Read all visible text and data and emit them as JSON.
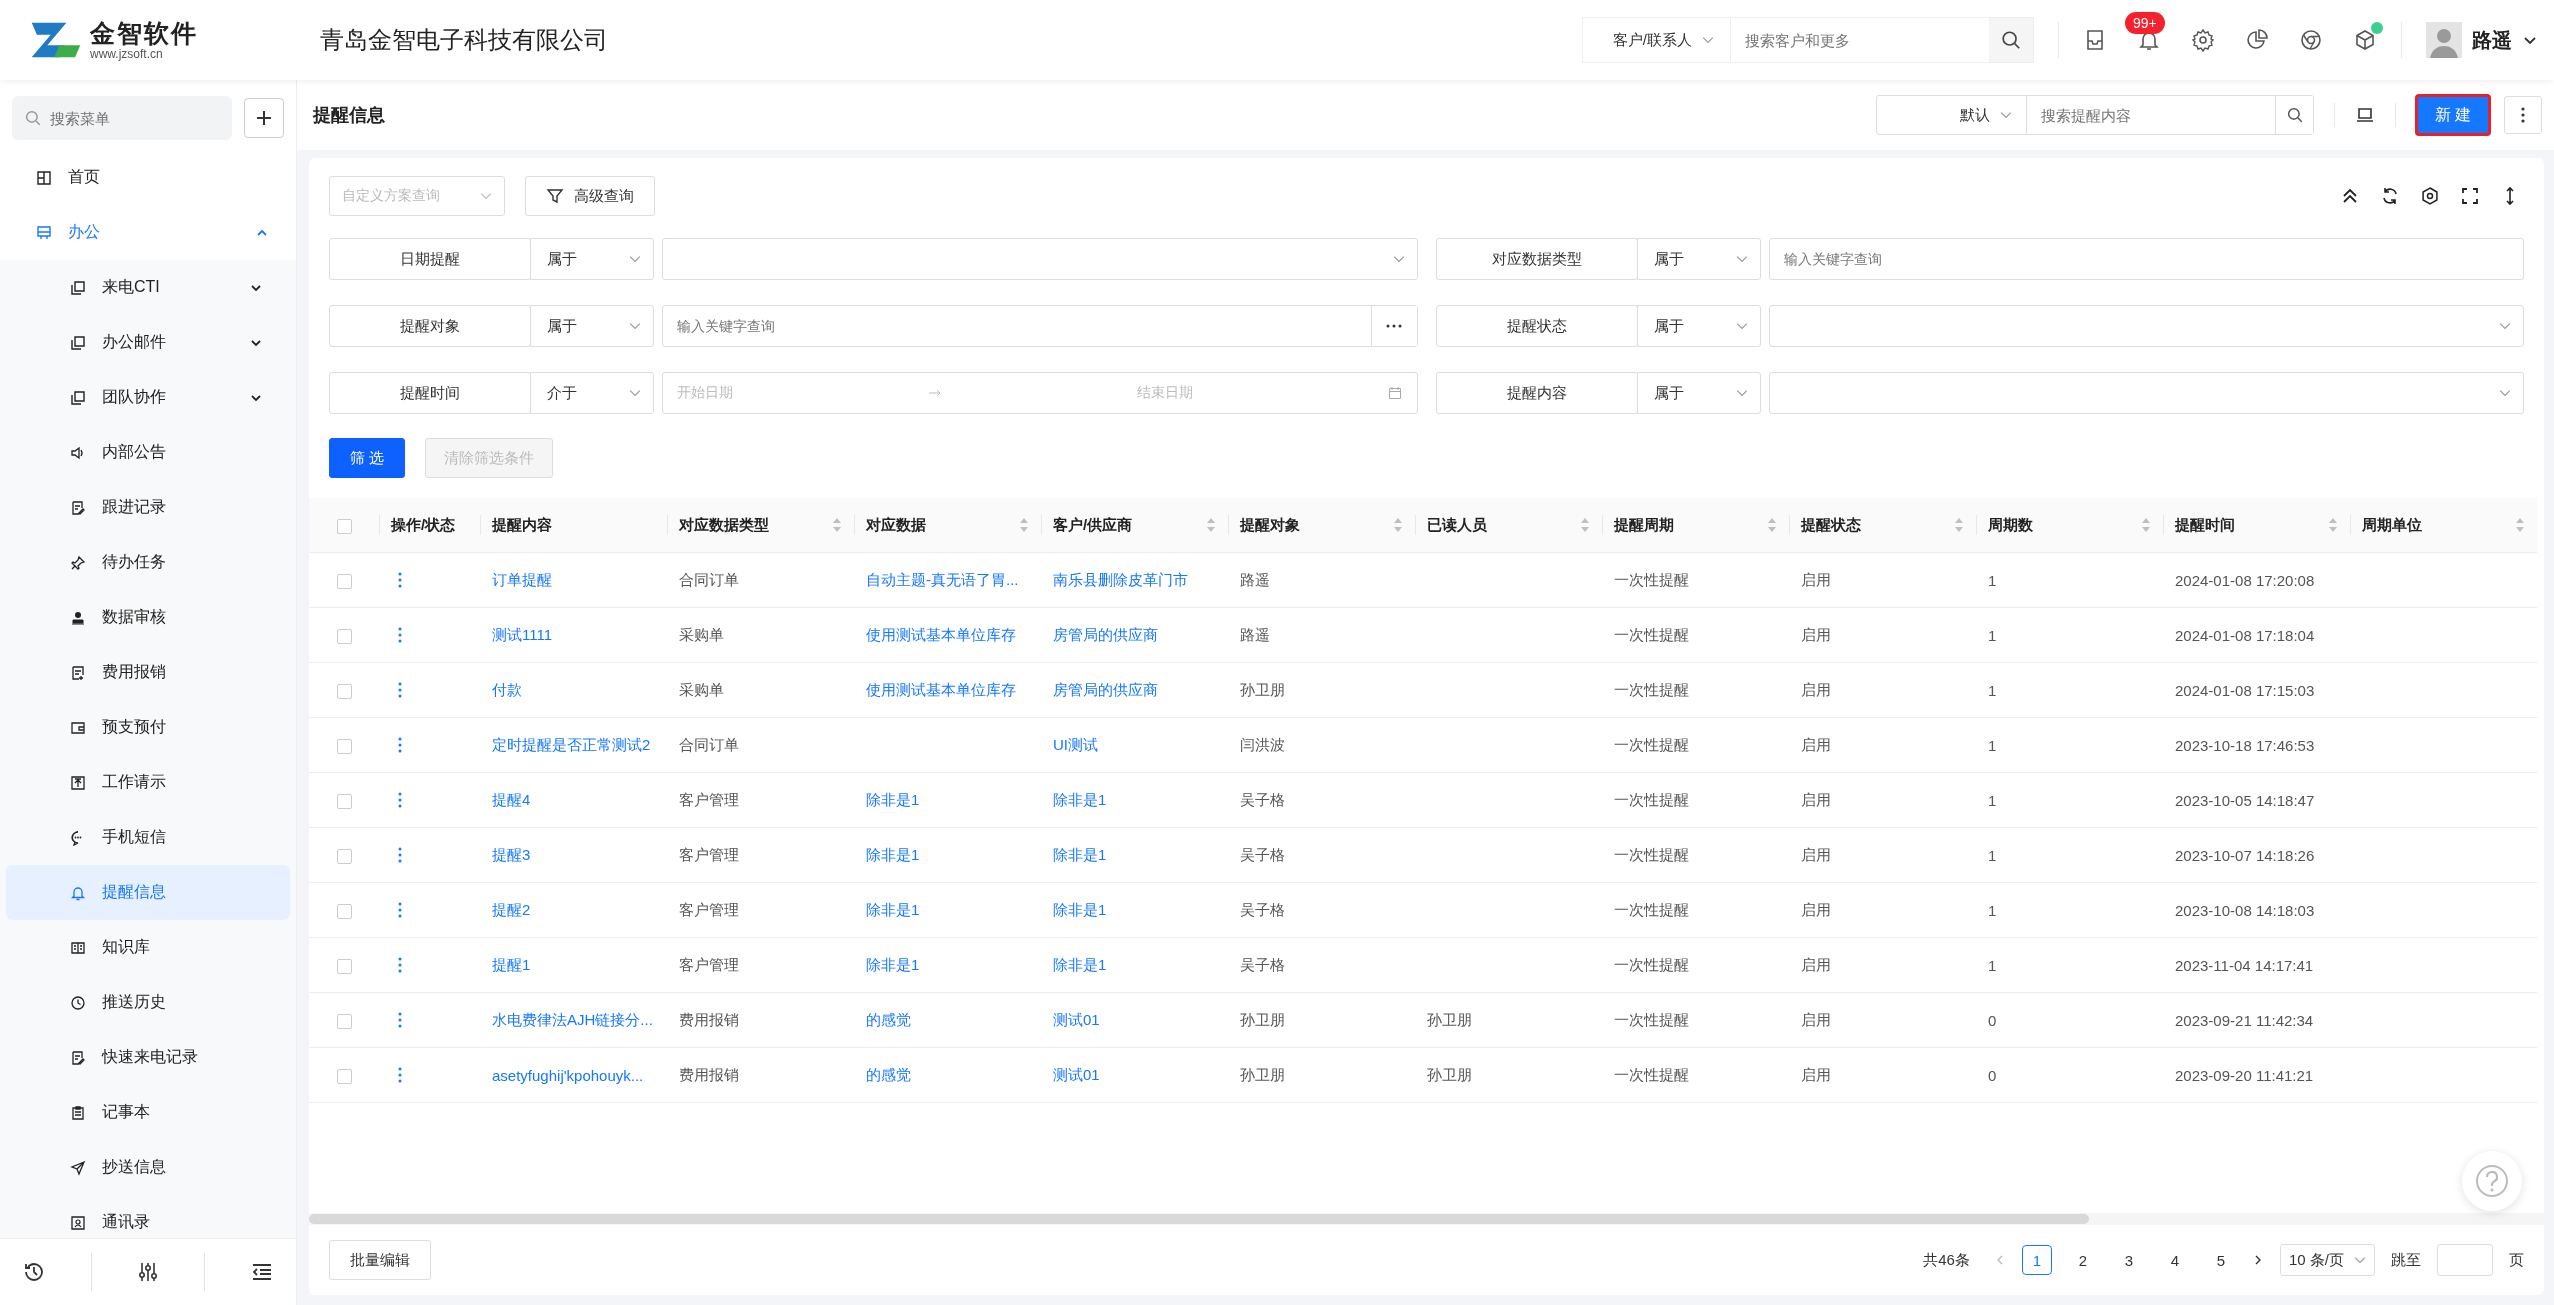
{
  "header": {
    "logo_name": "金智软件",
    "logo_url": "www.jzsoft.cn",
    "company": "青岛金智电子科技有限公司",
    "search_scope": "客户/联系人",
    "search_placeholder": "搜索客户和更多",
    "notification_badge": "99+",
    "user_name": "路遥"
  },
  "sidebar": {
    "search_placeholder": "搜索菜单",
    "items": [
      {
        "label": "首页",
        "selected": false
      },
      {
        "label": "办公",
        "selected": false,
        "expanded": true,
        "children": [
          {
            "label": "来电CTI",
            "selected": false,
            "expanded": false
          },
          {
            "label": "办公邮件",
            "selected": false,
            "expanded": false
          },
          {
            "label": "团队协作",
            "selected": false,
            "expanded": false
          },
          {
            "label": "内部公告",
            "selected": false
          },
          {
            "label": "跟进记录",
            "selected": false
          },
          {
            "label": "待办任务",
            "selected": false
          },
          {
            "label": "数据审核",
            "selected": false
          },
          {
            "label": "费用报销",
            "selected": false
          },
          {
            "label": "预支预付",
            "selected": false
          },
          {
            "label": "工作请示",
            "selected": false
          },
          {
            "label": "手机短信",
            "selected": false
          },
          {
            "label": "提醒信息",
            "selected": true
          },
          {
            "label": "知识库",
            "selected": false
          },
          {
            "label": "推送历史",
            "selected": false
          },
          {
            "label": "快速来电记录",
            "selected": false
          },
          {
            "label": "记事本",
            "selected": false
          },
          {
            "label": "抄送信息",
            "selected": false
          },
          {
            "label": "通讯录",
            "selected": false
          }
        ]
      }
    ]
  },
  "page": {
    "title": "提醒信息",
    "view": "默认",
    "search_placeholder": "搜索提醒内容",
    "new_button": {
      "label": "新 建",
      "focused": true
    }
  },
  "filter_bar": {
    "scheme_placeholder": "自定义方案查询",
    "advanced_button": "高级查询",
    "filters": [
      {
        "label": "日期提醒",
        "operator": "属于",
        "kind": "select"
      },
      {
        "label": "对应数据类型",
        "operator": "属于",
        "kind": "text",
        "placeholder": "输入关键字查询"
      },
      {
        "label": "提醒对象",
        "operator": "属于",
        "kind": "lookup",
        "placeholder": "输入关键字查询"
      },
      {
        "label": "提醒状态",
        "operator": "属于",
        "kind": "select"
      },
      {
        "label": "提醒时间",
        "operator": "介于",
        "kind": "daterange",
        "start_placeholder": "开始日期",
        "end_placeholder": "结束日期"
      },
      {
        "label": "提醒内容",
        "operator": "属于",
        "kind": "select"
      }
    ],
    "buttons": [
      {
        "label": "筛 选",
        "kind": "primary",
        "disabled": false
      },
      {
        "label": "清除筛选条件",
        "kind": "default",
        "disabled": true
      }
    ]
  },
  "table": {
    "select_all_checked": false,
    "actions_column": "操作/状态",
    "columns": [
      {
        "label": "提醒内容",
        "sortable": false,
        "kind": "link"
      },
      {
        "label": "对应数据类型",
        "sortable": true,
        "kind": "text"
      },
      {
        "label": "对应数据",
        "sortable": true,
        "kind": "link"
      },
      {
        "label": "客户/供应商",
        "sortable": true,
        "kind": "link"
      },
      {
        "label": "提醒对象",
        "sortable": true,
        "kind": "text"
      },
      {
        "label": "已读人员",
        "sortable": true,
        "kind": "text"
      },
      {
        "label": "提醒周期",
        "sortable": true,
        "kind": "text"
      },
      {
        "label": "提醒状态",
        "sortable": true,
        "kind": "text"
      },
      {
        "label": "周期数",
        "sortable": true,
        "kind": "text"
      },
      {
        "label": "提醒时间",
        "sortable": true,
        "kind": "text"
      },
      {
        "label": "周期单位",
        "sortable": true
      }
    ],
    "rows": [
      {
        "checked": false,
        "cells": [
          "订单提醒",
          "合同订单",
          "自动主题-真无语了胃...",
          "南乐县删除皮革门市",
          "路遥",
          null,
          "一次性提醒",
          "启用",
          "1",
          "2024-01-08 17:20:08",
          null
        ]
      },
      {
        "checked": false,
        "cells": [
          "测试1111",
          "采购单",
          "使用测试基本单位库存",
          "房管局的供应商",
          "路遥",
          null,
          "一次性提醒",
          "启用",
          "1",
          "2024-01-08 17:18:04",
          null
        ]
      },
      {
        "checked": false,
        "cells": [
          "付款",
          "采购单",
          "使用测试基本单位库存",
          "房管局的供应商",
          "孙卫朋",
          null,
          "一次性提醒",
          "启用",
          "1",
          "2024-01-08 17:15:03",
          null
        ]
      },
      {
        "checked": false,
        "cells": [
          "定时提醒是否正常测试2",
          "合同订单",
          null,
          "UI测试",
          "闫洪波",
          null,
          "一次性提醒",
          "启用",
          "1",
          "2023-10-18 17:46:53",
          null
        ]
      },
      {
        "checked": false,
        "cells": [
          "提醒4",
          "客户管理",
          "除非是1",
          "除非是1",
          "吴子格",
          null,
          "一次性提醒",
          "启用",
          "1",
          "2023-10-05 14:18:47",
          null
        ]
      },
      {
        "checked": false,
        "cells": [
          "提醒3",
          "客户管理",
          "除非是1",
          "除非是1",
          "吴子格",
          null,
          "一次性提醒",
          "启用",
          "1",
          "2023-10-07 14:18:26",
          null
        ]
      },
      {
        "checked": false,
        "cells": [
          "提醒2",
          "客户管理",
          "除非是1",
          "除非是1",
          "吴子格",
          null,
          "一次性提醒",
          "启用",
          "1",
          "2023-10-08 14:18:03",
          null
        ]
      },
      {
        "checked": false,
        "cells": [
          "提醒1",
          "客户管理",
          "除非是1",
          "除非是1",
          "吴子格",
          null,
          "一次性提醒",
          "启用",
          "1",
          "2023-11-04 14:17:41",
          null
        ]
      },
      {
        "checked": false,
        "cells": [
          "水电费律法AJH链接分...",
          "费用报销",
          "的感觉",
          "测试01",
          "孙卫朋",
          "孙卫朋",
          "一次性提醒",
          "启用",
          "0",
          "2023-09-21 11:42:34",
          null
        ]
      },
      {
        "checked": false,
        "cells": [
          "asetyfughij'kpohouyk...",
          "费用报销",
          "的感觉",
          "测试01",
          "孙卫朋",
          "孙卫朋",
          "一次性提醒",
          "启用",
          "0",
          "2023-09-20 11:41:21",
          null
        ]
      }
    ]
  },
  "footer": {
    "batch_button": "批量编辑",
    "total": "共46条",
    "pages": [
      {
        "label": "1",
        "selected": true
      },
      {
        "label": "2",
        "selected": false
      },
      {
        "label": "3",
        "selected": false
      },
      {
        "label": "4",
        "selected": false
      },
      {
        "label": "5",
        "selected": false
      }
    ],
    "page_size": "10 条/页",
    "jump_label": "跳至",
    "page_unit": "页"
  }
}
